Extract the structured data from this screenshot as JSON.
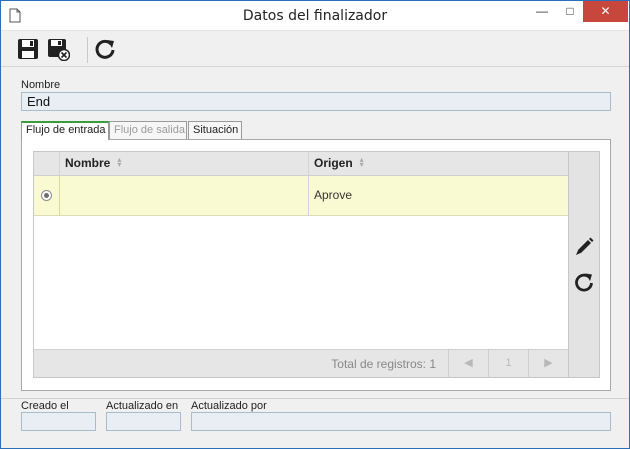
{
  "window": {
    "title": "Datos del finalizador",
    "minimize_glyph": "—",
    "maximize_glyph": "□",
    "close_glyph": "✕"
  },
  "toolbar": {
    "items": [
      "save-icon",
      "save-and-close-icon",
      "refresh-icon"
    ]
  },
  "form": {
    "name_label": "Nombre",
    "name_value": "End"
  },
  "tabs": [
    {
      "label": "Flujo de entrada",
      "state": "active"
    },
    {
      "label": "Flujo de salida",
      "state": "disabled"
    },
    {
      "label": "Situación",
      "state": "normal"
    }
  ],
  "grid": {
    "columns": [
      "Nombre",
      "Origen"
    ],
    "rows": [
      {
        "selected": true,
        "nombre": "",
        "origen": "Aprove"
      }
    ],
    "total_label": "Total de registros: 1",
    "pager": {
      "prev": "◀",
      "page": "1",
      "next": "▶"
    }
  },
  "side_actions": [
    "edit-icon",
    "refresh-icon"
  ],
  "footer": {
    "created_label": "Creado el",
    "created_value": "",
    "updated_label": "Actualizado en",
    "updated_value": "",
    "updated_by_label": "Actualizado por",
    "updated_by_value": ""
  },
  "colors": {
    "selected_row": "#fafad2",
    "close_button": "#c7473c",
    "active_tab_accent": "#3b9c3b",
    "field_bg": "#e8eef3"
  }
}
